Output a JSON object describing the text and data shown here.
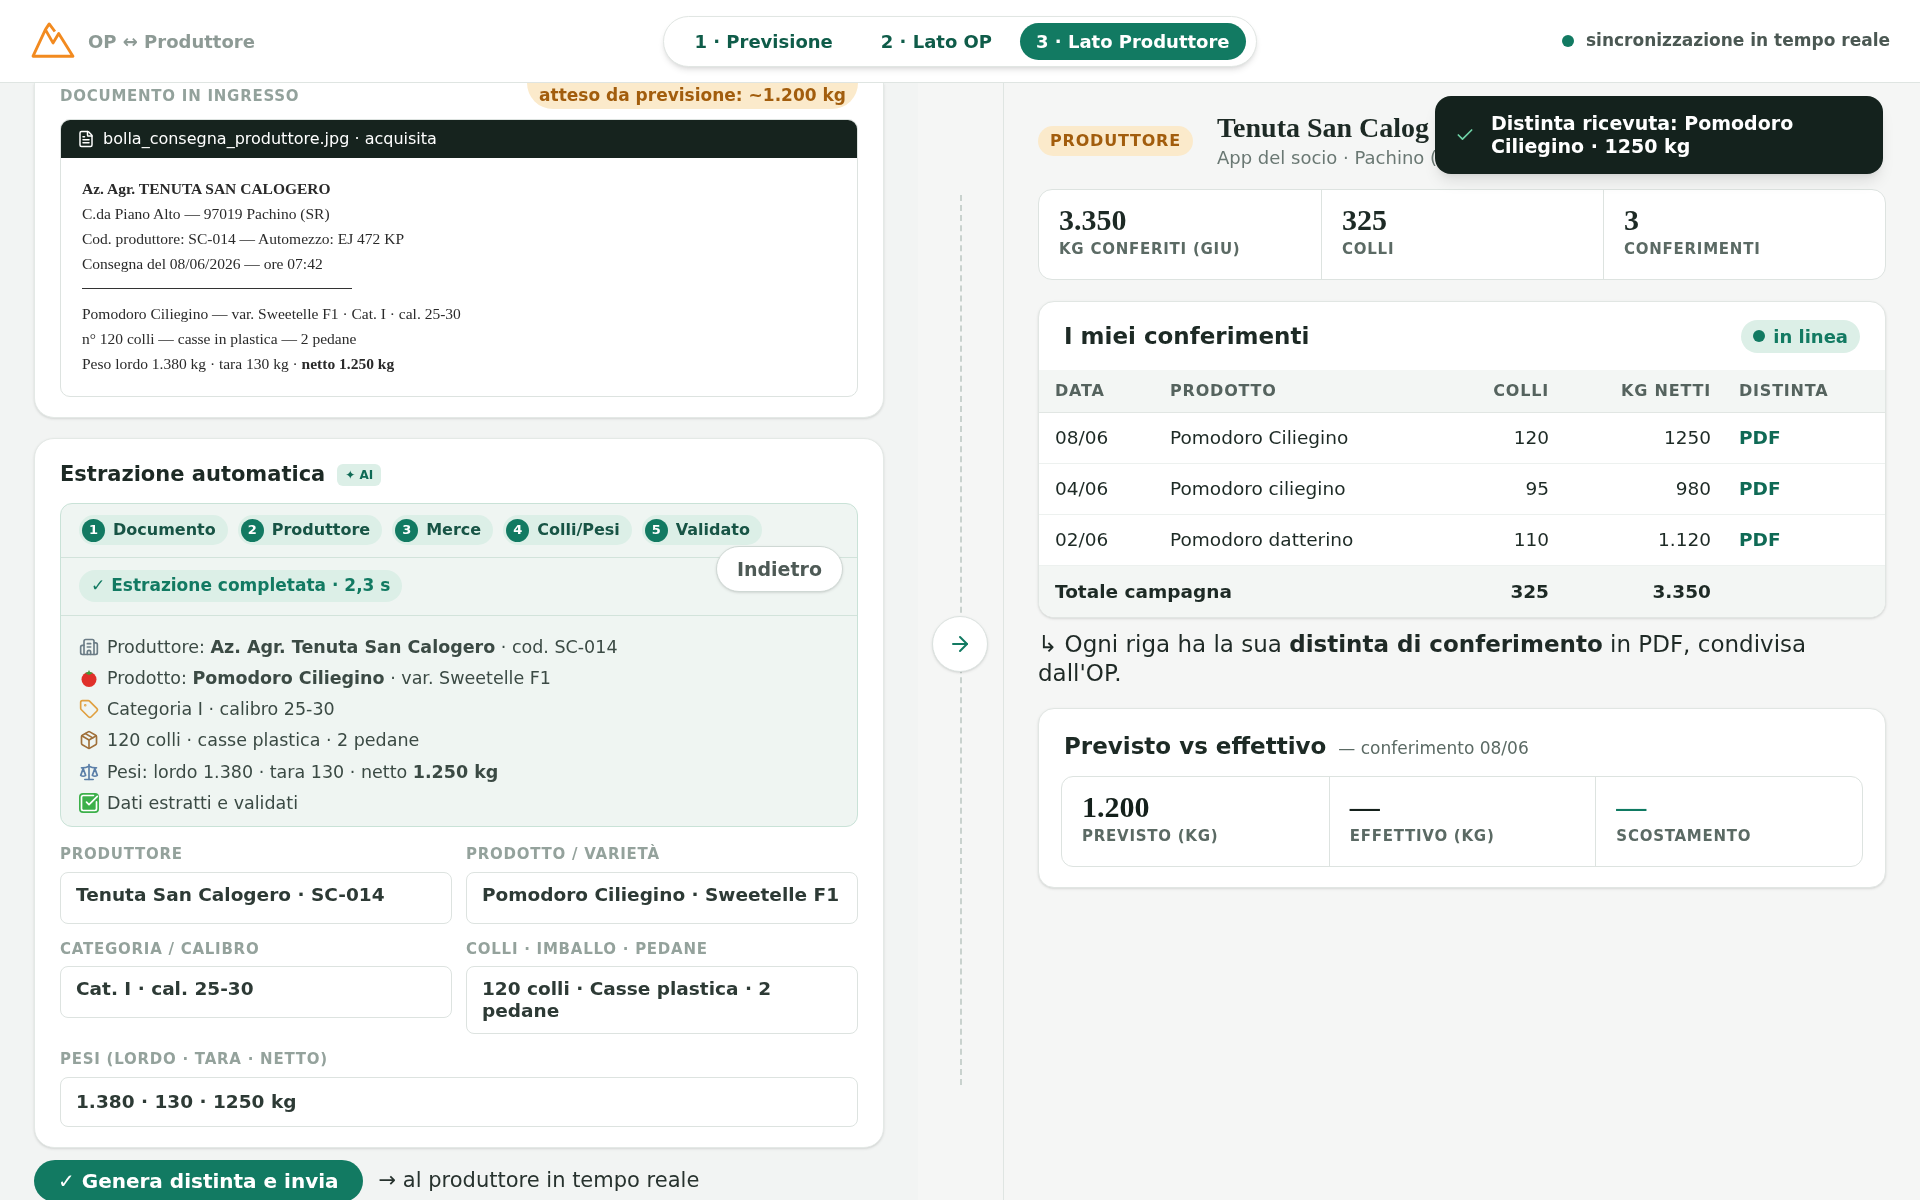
{
  "header": {
    "brand": "OP ↔ Produttore",
    "steps": [
      {
        "label": "1 · Previsione",
        "selected": false
      },
      {
        "label": "2 · Lato OP",
        "selected": false
      },
      {
        "label": "3 · Lato Produttore",
        "selected": true
      }
    ],
    "sync": "sincronizzazione in tempo reale"
  },
  "document": {
    "label": "DOCUMENTO IN INGRESSO",
    "expected": "atteso da previsione: ~1.200 kg",
    "file": "bolla_consegna_produttore.jpg · acquisita",
    "company": "Az. Agr. TENUTA SAN CALOGERO",
    "address_lines": [
      "C.da Piano Alto — 97019 Pachino (SR)",
      "Cod. produttore: SC-014 — Automezzo: EJ 472 KP",
      "Consegna del 08/06/2026 — ore 07:42"
    ],
    "goods_lines": [
      "Pomodoro Ciliegino — var. Sweetelle F1 · Cat. I · cal. 25-30",
      "n° 120 colli — casse in plastica — 2 pedane",
      "Peso lordo 1.380 kg · tara 130 kg · **netto 1.250 kg**"
    ]
  },
  "extraction": {
    "title": "Estrazione automatica",
    "badge": "✦ AI",
    "steps": [
      {
        "number": "1",
        "label": "Documento"
      },
      {
        "number": "2",
        "label": "Produttore"
      },
      {
        "number": "3",
        "label": "Merce"
      },
      {
        "number": "4",
        "label": "Colli/Pesi"
      },
      {
        "number": "5",
        "label": "Validato"
      }
    ],
    "status": "✓ Estrazione completata · 2,3 s",
    "back_button": "Indietro",
    "items": [
      {
        "kind": "producer",
        "text": "Produttore: **Az. Agr. Tenuta San Calogero** · cod. SC-014"
      },
      {
        "kind": "product",
        "text": "Prodotto: **Pomodoro Ciliegino** · var. Sweetelle F1"
      },
      {
        "kind": "category",
        "text": "Categoria I · calibro 25-30"
      },
      {
        "kind": "packaging",
        "text": "120 colli · casse plastica · 2 pedane"
      },
      {
        "kind": "weights",
        "text": "Pesi: lordo 1.380 · tara 130 · netto **1.250 kg**"
      },
      {
        "kind": "validated",
        "text": "Dati estratti e validati"
      }
    ],
    "fields": [
      {
        "label": "PRODUTTORE",
        "value": "Tenuta San Calogero · SC-014"
      },
      {
        "label": "PRODOTTO / VARIETÀ",
        "value": "Pomodoro Ciliegino · Sweetelle F1"
      },
      {
        "label": "CATEGORIA / CALIBRO",
        "value": "Cat. I · cal. 25-30"
      },
      {
        "label": "COLLI · IMBALLO · PEDANE",
        "value": "120 colli · Casse plastica · 2 pedane"
      }
    ],
    "weights_field": {
      "label": "PESI (LORDO · TARA · NETTO)",
      "value": "1.380 · 130 · 1250 kg"
    }
  },
  "action": {
    "button": "✓ Genera distinta e invia",
    "note": "→ al produttore in tempo reale"
  },
  "producer": {
    "badge": "PRODUTTORE",
    "name": "Tenuta San Calog",
    "subtitle": "App del socio · Pachino (",
    "toast": "Distinta ricevuta: Pomodoro Ciliegino · 1250 kg",
    "stats": [
      {
        "value": "3.350",
        "label": "KG CONFERITI (GIU)"
      },
      {
        "value": "325",
        "label": "COLLI"
      },
      {
        "value": "3",
        "label": "CONFERIMENTI"
      }
    ],
    "table": {
      "title": "I miei conferimenti",
      "status": "in linea",
      "columns": [
        "DATA",
        "PRODOTTO",
        "COLLI",
        "KG NETTI",
        "DISTINTA"
      ],
      "rows": [
        {
          "date": "08/06",
          "product": "Pomodoro Ciliegino",
          "colli": "120",
          "kg": "1250",
          "distinta": "PDF"
        },
        {
          "date": "04/06",
          "product": "Pomodoro ciliegino",
          "colli": "95",
          "kg": "980",
          "distinta": "PDF"
        },
        {
          "date": "02/06",
          "product": "Pomodoro datterino",
          "colli": "110",
          "kg": "1.120",
          "distinta": "PDF"
        }
      ],
      "total": {
        "label": "Totale campagna",
        "colli": "325",
        "kg": "3.350"
      }
    },
    "note": "↳ Ogni riga ha la sua **distinta di conferimento** in PDF, condivisa dall'OP.",
    "comparison": {
      "title": "Previsto vs effettivo",
      "subtitle": "— conferimento 08/06",
      "stats": [
        {
          "value": "1.200",
          "label": "PREVISTO (KG)",
          "color": "#14201b"
        },
        {
          "value": "—",
          "label": "EFFETTIVO (KG)",
          "color": "#14201b"
        },
        {
          "value": "—",
          "label": "SCOSTAMENTO",
          "color": "#0f7a62"
        }
      ]
    }
  }
}
